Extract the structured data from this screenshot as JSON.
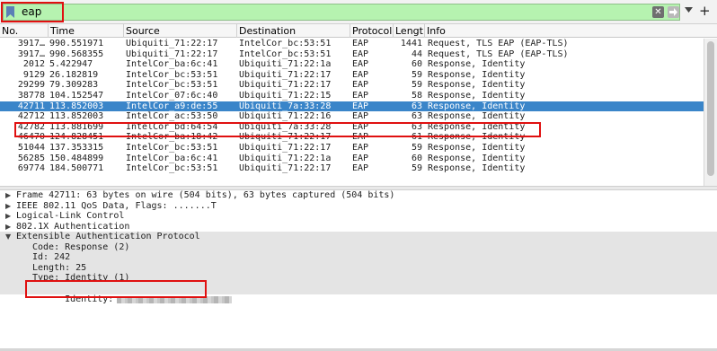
{
  "filter": {
    "value": "eap",
    "clear_icon": "clear-icon",
    "apply_icon": "arrow-right-icon",
    "bookmark_icon": "bookmark-icon",
    "history_icon": "chevron-down-icon",
    "add_icon_label": "+"
  },
  "columns": [
    "No.",
    "Time",
    "Source",
    "Destination",
    "Protocol",
    "Length",
    "Info"
  ],
  "packets": [
    {
      "no": "3917…",
      "time": "990.551971",
      "src": "Ubiquiti_71:22:17",
      "dst": "IntelCor_bc:53:51",
      "proto": "EAP",
      "len": "1441",
      "info": "Request, TLS EAP (EAP-TLS)"
    },
    {
      "no": "3917…",
      "time": "990.568355",
      "src": "Ubiquiti_71:22:17",
      "dst": "IntelCor_bc:53:51",
      "proto": "EAP",
      "len": "44",
      "info": "Request, TLS EAP (EAP-TLS)"
    },
    {
      "no": "2012",
      "time": "5.422947",
      "src": "IntelCor_ba:6c:41",
      "dst": "Ubiquiti_71:22:1a",
      "proto": "EAP",
      "len": "60",
      "info": "Response, Identity"
    },
    {
      "no": "9129",
      "time": "26.182819",
      "src": "IntelCor_bc:53:51",
      "dst": "Ubiquiti_71:22:17",
      "proto": "EAP",
      "len": "59",
      "info": "Response, Identity"
    },
    {
      "no": "29299",
      "time": "79.309283",
      "src": "IntelCor_bc:53:51",
      "dst": "Ubiquiti_71:22:17",
      "proto": "EAP",
      "len": "59",
      "info": "Response, Identity"
    },
    {
      "no": "38778",
      "time": "104.152547",
      "src": "IntelCor_07:6c:40",
      "dst": "Ubiquiti_71:22:15",
      "proto": "EAP",
      "len": "58",
      "info": "Response, Identity"
    },
    {
      "no": "42711",
      "time": "113.852003",
      "src": "IntelCor_a9:de:55",
      "dst": "Ubiquiti_7a:33:28",
      "proto": "EAP",
      "len": "63",
      "info": "Response, Identity"
    },
    {
      "no": "42712",
      "time": "113.852003",
      "src": "IntelCor_ac:53:50",
      "dst": "Ubiquiti_71:22:16",
      "proto": "EAP",
      "len": "63",
      "info": "Response, Identity"
    },
    {
      "no": "42782",
      "time": "113.881699",
      "src": "IntelCor_bd:64:54",
      "dst": "Ubiquiti_7a:33:28",
      "proto": "EAP",
      "len": "63",
      "info": "Response, Identity"
    },
    {
      "no": "46470",
      "time": "124.828451",
      "src": "IntelCor_ba:18:42",
      "dst": "Ubiquiti_71:22:17",
      "proto": "EAP",
      "len": "61",
      "info": "Response, Identity"
    },
    {
      "no": "51044",
      "time": "137.353315",
      "src": "IntelCor_bc:53:51",
      "dst": "Ubiquiti_71:22:17",
      "proto": "EAP",
      "len": "59",
      "info": "Response, Identity"
    },
    {
      "no": "56285",
      "time": "150.484899",
      "src": "IntelCor_ba:6c:41",
      "dst": "Ubiquiti_71:22:1a",
      "proto": "EAP",
      "len": "60",
      "info": "Response, Identity"
    },
    {
      "no": "69774",
      "time": "184.500771",
      "src": "IntelCor_bc:53:51",
      "dst": "Ubiquiti_71:22:17",
      "proto": "EAP",
      "len": "59",
      "info": "Response, Identity"
    }
  ],
  "selected_packet_index": 6,
  "details": {
    "frame": "Frame 42711: 63 bytes on wire (504 bits), 63 bytes captured (504 bits)",
    "ieee": "IEEE 802.11 QoS Data, Flags: .......T",
    "llc": "Logical-Link Control",
    "auth8021x": "802.1X Authentication",
    "eap": "Extensible Authentication Protocol",
    "code": "Code: Response (2)",
    "id": "Id: 242",
    "length": "Length: 25",
    "type": "Type: Identity (1)",
    "identity_label": "Identity:"
  },
  "colors": {
    "filter_valid": "#b6f3b0",
    "selection": "#3a85c9",
    "annotation": "#e01010"
  }
}
